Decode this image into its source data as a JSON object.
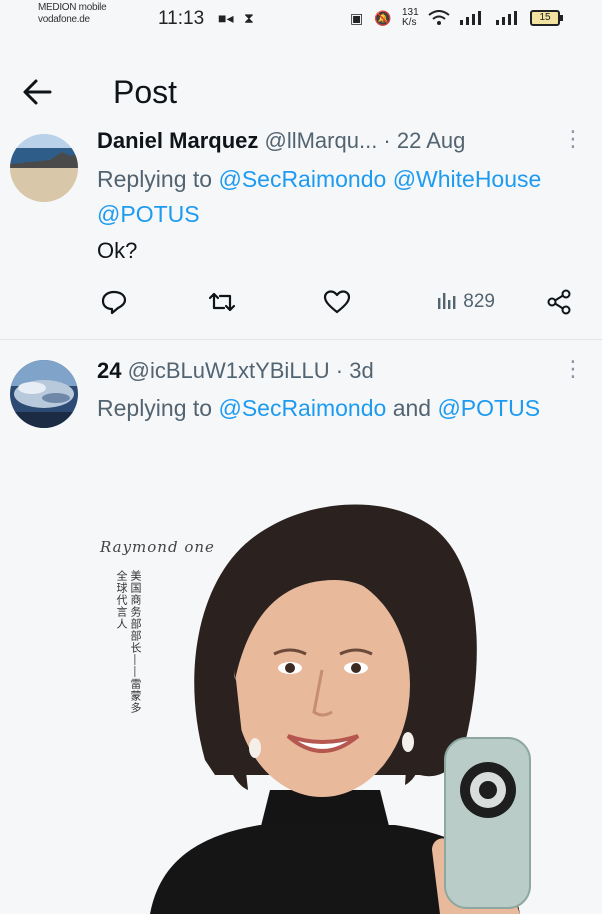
{
  "status_bar": {
    "carrier_line1": "MEDION mobile",
    "carrier_line2": "vodafone.de",
    "time": "11:13",
    "net_speed_value": "131",
    "net_speed_unit": "K/s",
    "battery": "15",
    "icons": [
      "video-icon",
      "hourglass-icon",
      "vibrate-icon",
      "mute-icon",
      "wifi-icon",
      "signal-icon",
      "signal-icon",
      "battery-icon"
    ]
  },
  "header": {
    "title": "Post"
  },
  "tweets": [
    {
      "display_name": "Daniel Marquez",
      "handle_time": "@llMarqu... · 22 Aug",
      "reply_prefix": "Replying to",
      "mention_1": "@SecRaimondo",
      "mention_2": "@WhiteHouse",
      "mention_3": "@POTUS",
      "text": "Ok?",
      "views": "829"
    },
    {
      "display_name": "24",
      "handle_time": "@icBLuW1xtYBiLLU · 3d",
      "reply_prefix": "Replying to",
      "mention_1": "@SecRaimondo",
      "reply_joiner": "and",
      "mention_2": "@POTUS",
      "media": {
        "vertical_caption_1": "美国商务部部长——雷蒙多",
        "vertical_caption_2": "全球代言人",
        "signature": "Raymond one"
      }
    }
  ],
  "colors": {
    "accent": "#1d9bf0",
    "secondary_text": "#536471",
    "primary_text": "#0f1419",
    "background": "#f6f7f9"
  }
}
